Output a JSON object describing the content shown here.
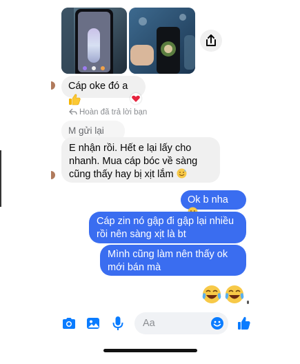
{
  "chat": {
    "reply_notice": "Hoàn đã trả lời bạn",
    "quoted_message": "M gửi lại nhé",
    "messages_in": [
      {
        "text": "Cáp oke đó a"
      },
      {
        "text": "E nhận rồi. Hết e lại lấy cho nhanh. Mua cáp bóc về sàng cũng thấy hay bị xịt lắm"
      }
    ],
    "messages_out": [
      {
        "text": "Ok b nha"
      },
      {
        "text": "Cáp zin nó gập đi gập lại nhiều rồi nên sàng xịt là bt"
      },
      {
        "text": "Mình cũng làm nên thấy ok mới bán mà"
      }
    ],
    "reaction": "heart"
  },
  "composer": {
    "placeholder": "Aa"
  },
  "colors": {
    "outgoing_bubble": "#3a6df0",
    "incoming_bubble": "#f0f0f0",
    "accent": "#0a7cff"
  }
}
